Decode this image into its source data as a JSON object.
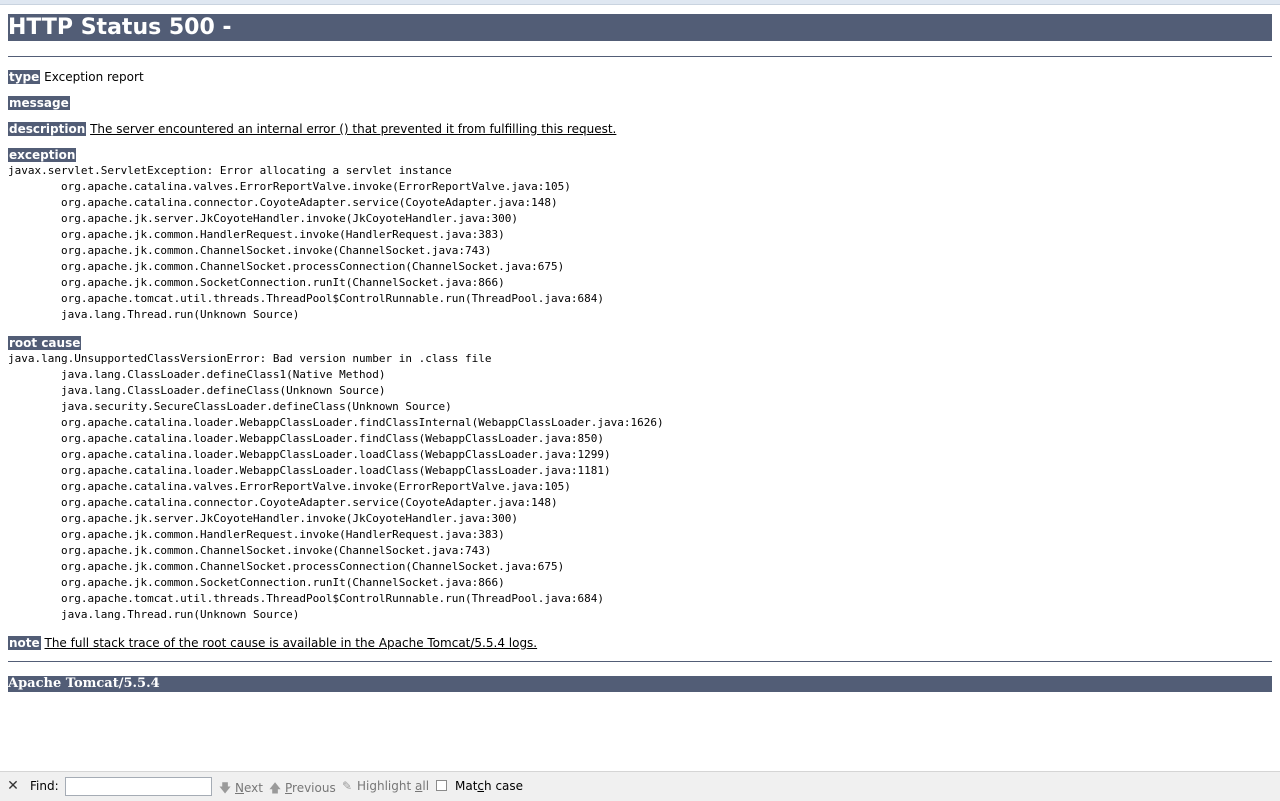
{
  "title": "HTTP Status 500 -",
  "type": {
    "label": "type",
    "value": "Exception report"
  },
  "message": {
    "label": "message",
    "value": ""
  },
  "description": {
    "label": "description",
    "value": "The server encountered an internal error () that prevented it from fulfilling this request."
  },
  "exception": {
    "label": "exception",
    "trace": [
      "javax.servlet.ServletException: Error allocating a servlet instance",
      "\torg.apache.catalina.valves.ErrorReportValve.invoke(ErrorReportValve.java:105)",
      "\torg.apache.catalina.connector.CoyoteAdapter.service(CoyoteAdapter.java:148)",
      "\torg.apache.jk.server.JkCoyoteHandler.invoke(JkCoyoteHandler.java:300)",
      "\torg.apache.jk.common.HandlerRequest.invoke(HandlerRequest.java:383)",
      "\torg.apache.jk.common.ChannelSocket.invoke(ChannelSocket.java:743)",
      "\torg.apache.jk.common.ChannelSocket.processConnection(ChannelSocket.java:675)",
      "\torg.apache.jk.common.SocketConnection.runIt(ChannelSocket.java:866)",
      "\torg.apache.tomcat.util.threads.ThreadPool$ControlRunnable.run(ThreadPool.java:684)",
      "\tjava.lang.Thread.run(Unknown Source)"
    ]
  },
  "root_cause": {
    "label": "root cause",
    "trace": [
      "java.lang.UnsupportedClassVersionError: Bad version number in .class file",
      "\tjava.lang.ClassLoader.defineClass1(Native Method)",
      "\tjava.lang.ClassLoader.defineClass(Unknown Source)",
      "\tjava.security.SecureClassLoader.defineClass(Unknown Source)",
      "\torg.apache.catalina.loader.WebappClassLoader.findClassInternal(WebappClassLoader.java:1626)",
      "\torg.apache.catalina.loader.WebappClassLoader.findClass(WebappClassLoader.java:850)",
      "\torg.apache.catalina.loader.WebappClassLoader.loadClass(WebappClassLoader.java:1299)",
      "\torg.apache.catalina.loader.WebappClassLoader.loadClass(WebappClassLoader.java:1181)",
      "\torg.apache.catalina.valves.ErrorReportValve.invoke(ErrorReportValve.java:105)",
      "\torg.apache.catalina.connector.CoyoteAdapter.service(CoyoteAdapter.java:148)",
      "\torg.apache.jk.server.JkCoyoteHandler.invoke(JkCoyoteHandler.java:300)",
      "\torg.apache.jk.common.HandlerRequest.invoke(HandlerRequest.java:383)",
      "\torg.apache.jk.common.ChannelSocket.invoke(ChannelSocket.java:743)",
      "\torg.apache.jk.common.ChannelSocket.processConnection(ChannelSocket.java:675)",
      "\torg.apache.jk.common.SocketConnection.runIt(ChannelSocket.java:866)",
      "\torg.apache.tomcat.util.threads.ThreadPool$ControlRunnable.run(ThreadPool.java:684)",
      "\tjava.lang.Thread.run(Unknown Source)"
    ]
  },
  "note": {
    "label": "note",
    "value": "The full stack trace of the root cause is available in the Apache Tomcat/5.5.4 logs."
  },
  "server_footer": "Apache Tomcat/5.5.4",
  "findbar": {
    "close_icon": "close-icon",
    "label": "Find:",
    "input_value": "",
    "next": {
      "pre": "",
      "acc": "N",
      "post": "ext"
    },
    "previous": {
      "pre": "",
      "acc": "P",
      "post": "revious"
    },
    "highlight": {
      "pre": "Highlight ",
      "acc": "a",
      "post": "ll"
    },
    "match_case": {
      "pre": "Mat",
      "acc": "c",
      "post": "h case"
    },
    "match_case_checked": false
  },
  "colors": {
    "header_bg": "#525d76",
    "header_fg": "#ffffff"
  }
}
